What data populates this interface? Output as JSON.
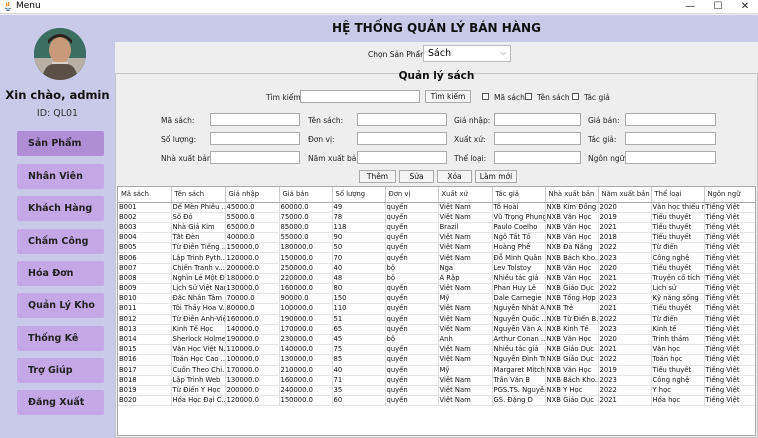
{
  "window": {
    "title": "Menu",
    "minimize": "—",
    "maximize": "☐",
    "close": "✕"
  },
  "sidebar": {
    "greeting": "Xin chào, admin",
    "user_id": "ID: QL01",
    "items": [
      {
        "label": "Sản Phẩm"
      },
      {
        "label": "Nhân Viên"
      },
      {
        "label": "Khách Hàng"
      },
      {
        "label": "Chấm Công"
      },
      {
        "label": "Hóa Đơn"
      },
      {
        "label": "Quản Lý Kho"
      },
      {
        "label": "Thống Kê"
      },
      {
        "label": "Trợ Giúp"
      },
      {
        "label": "Đăng Xuất"
      }
    ]
  },
  "header": {
    "title": "HỆ THỐNG QUẢN LÝ BÁN HÀNG"
  },
  "product_select": {
    "label": "Chọn Sản Phẩm:",
    "value": "Sách"
  },
  "panel": {
    "title": "Quản lý sách",
    "search": {
      "label": "Tìm kiếm:",
      "value": "",
      "button": "Tìm kiếm",
      "checkboxes": [
        "Mã sách",
        "Tên sách",
        "Tác giả"
      ]
    },
    "fields": {
      "ma_sach": "Mã sách:",
      "ten_sach": "Tên sách:",
      "gia_nhap": "Giá nhập:",
      "gia_ban": "Giá bán:",
      "so_luong": "Số lượng:",
      "don_vi": "Đơn vị:",
      "xuat_xu": "Xuất xứ:",
      "tac_gia": "Tác giả:",
      "nxb": "Nhà xuất bản:",
      "nam_xb": "Năm xuất bản:",
      "the_loai": "Thể loại:",
      "ngon_ngu": "Ngôn ngữ:"
    },
    "buttons": {
      "add": "Thêm",
      "edit": "Sửa",
      "delete": "Xóa",
      "reset": "Làm mới"
    }
  },
  "table": {
    "columns": [
      "Mã sách",
      "Tên sách",
      "Giá nhập",
      "Giá bán",
      "Số lượng",
      "Đơn vị",
      "Xuất xứ",
      "Tác giả",
      "Nhà xuất bản",
      "Năm xuất bản",
      "Thể loại",
      "Ngôn ngữ"
    ],
    "rows": [
      [
        "B001",
        "Dế Mèn Phiêu ...",
        "45000.0",
        "60000.0",
        "49",
        "quyển",
        "Việt Nam",
        "Tô Hoài",
        "NXB Kim Đồng",
        "2020",
        "Văn học thiếu nhi",
        "Tiếng Việt"
      ],
      [
        "B002",
        "Số Đỏ",
        "55000.0",
        "75000.0",
        "78",
        "quyển",
        "Việt Nam",
        "Vũ Trọng Phụng",
        "NXB Văn Học",
        "2019",
        "Tiểu thuyết",
        "Tiếng Việt"
      ],
      [
        "B003",
        "Nhà Giả Kim",
        "65000.0",
        "85000.0",
        "118",
        "quyển",
        "Brazil",
        "Paulo Coelho",
        "NXB Văn Học",
        "2021",
        "Tiểu thuyết",
        "Tiếng Việt"
      ],
      [
        "B004",
        "Tắt Đèn",
        "40000.0",
        "55000.0",
        "90",
        "quyển",
        "Việt Nam",
        "Ngô Tất Tố",
        "NXB Văn Học",
        "2018",
        "Tiểu thuyết",
        "Tiếng Việt"
      ],
      [
        "B005",
        "Từ Điển Tiếng ...",
        "150000.0",
        "180000.0",
        "50",
        "quyển",
        "Việt Nam",
        "Hoàng Phê",
        "NXB Đà Nẵng",
        "2022",
        "Từ điển",
        "Tiếng Việt"
      ],
      [
        "B006",
        "Lập Trình Pyth...",
        "120000.0",
        "150000.0",
        "70",
        "quyển",
        "Việt Nam",
        "Đỗ Minh Quân",
        "NXB Bách Kho...",
        "2023",
        "Công nghệ",
        "Tiếng Việt"
      ],
      [
        "B007",
        "Chiến Tranh v...",
        "200000.0",
        "250000.0",
        "40",
        "bộ",
        "Nga",
        "Lev Tolstoy",
        "NXB Văn Học",
        "2020",
        "Tiểu thuyết",
        "Tiếng Việt"
      ],
      [
        "B008",
        "Nghìn Lẻ Một Đ...",
        "180000.0",
        "220000.0",
        "48",
        "bộ",
        "Ả Rập",
        "Nhiều tác giả",
        "NXB Văn Học",
        "2021",
        "Truyện cổ tích",
        "Tiếng Việt"
      ],
      [
        "B009",
        "Lịch Sử Việt Nam",
        "130000.0",
        "160000.0",
        "80",
        "quyển",
        "Việt Nam",
        "Phan Huy Lê",
        "NXB Giáo Dục",
        "2022",
        "Lịch sử",
        "Tiếng Việt"
      ],
      [
        "B010",
        "Đắc Nhân Tâm",
        "70000.0",
        "90000.0",
        "150",
        "quyển",
        "Mỹ",
        "Dale Carnegie",
        "NXB Tổng Hợp ...",
        "2023",
        "Kỹ năng sống",
        "Tiếng Việt"
      ],
      [
        "B011",
        "Tôi Thấy Hoa V...",
        "80000.0",
        "100000.0",
        "110",
        "quyển",
        "Việt Nam",
        "Nguyễn Nhật Ánh",
        "NXB Trẻ",
        "2021",
        "Tiểu thuyết",
        "Tiếng Việt"
      ],
      [
        "B012",
        "Từ Điển Anh-Việt",
        "160000.0",
        "190000.0",
        "51",
        "quyển",
        "Việt Nam",
        "Nguyễn Quốc ...",
        "NXB Từ Điển B...",
        "2022",
        "Từ điển",
        "Tiếng Việt"
      ],
      [
        "B013",
        "Kinh Tế Học",
        "140000.0",
        "170000.0",
        "65",
        "quyển",
        "Việt Nam",
        "Nguyễn Văn A",
        "NXB Kinh Tế",
        "2023",
        "Kinh tế",
        "Tiếng Việt"
      ],
      [
        "B014",
        "Sherlock Holmes",
        "190000.0",
        "230000.0",
        "45",
        "bộ",
        "Anh",
        "Arthur Conan ...",
        "NXB Văn Học",
        "2020",
        "Trinh thám",
        "Tiếng Việt"
      ],
      [
        "B015",
        "Văn Học Việt N...",
        "110000.0",
        "140000.0",
        "75",
        "quyển",
        "Việt Nam",
        "Nhiều tác giả",
        "NXB Giáo Dục",
        "2021",
        "Văn học",
        "Tiếng Việt"
      ],
      [
        "B016",
        "Toán Học Cao ...",
        "100000.0",
        "130000.0",
        "85",
        "quyển",
        "Việt Nam",
        "Nguyễn Đình Trí",
        "NXB Giáo Dục",
        "2022",
        "Toán học",
        "Tiếng Việt"
      ],
      [
        "B017",
        "Cuốn Theo Chi...",
        "170000.0",
        "210000.0",
        "40",
        "quyển",
        "Mỹ",
        "Margaret Mitchell",
        "NXB Văn Học",
        "2019",
        "Tiểu thuyết",
        "Tiếng Việt"
      ],
      [
        "B018",
        "Lập Trình Web",
        "130000.0",
        "160000.0",
        "71",
        "quyển",
        "Việt Nam",
        "Trần Văn B",
        "NXB Bách Kho...",
        "2023",
        "Công nghệ",
        "Tiếng Việt"
      ],
      [
        "B019",
        "Từ Điển Y Học",
        "200000.0",
        "240000.0",
        "35",
        "quyển",
        "Việt Nam",
        "PGS.TS. Nguyễ...",
        "NXB Y Học",
        "2022",
        "Y học",
        "Tiếng Việt"
      ],
      [
        "B020",
        "Hóa Học Đại C...",
        "120000.0",
        "150000.0",
        "60",
        "quyển",
        "Việt Nam",
        "GS. Đặng D",
        "NXB Giáo Dục",
        "2021",
        "Hóa học",
        "Tiếng Việt"
      ]
    ]
  }
}
